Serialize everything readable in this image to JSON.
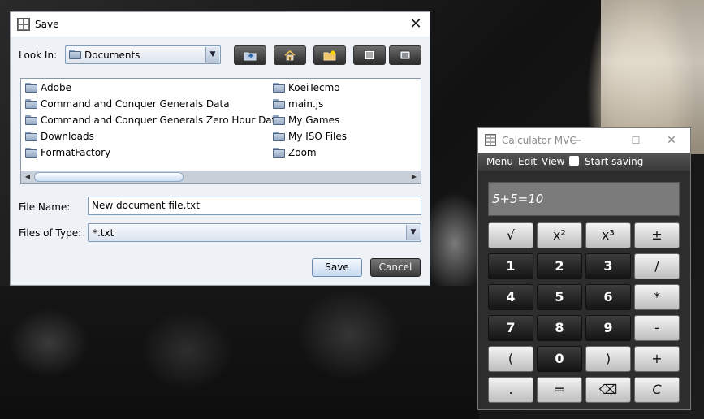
{
  "save_dialog": {
    "title": "Save",
    "close_glyph": "✕",
    "look_in_label": "Look In:",
    "look_in_value": "Documents",
    "toolbar": [
      {
        "icon": "up-folder-icon"
      },
      {
        "icon": "home-icon"
      },
      {
        "icon": "new-folder-icon"
      },
      {
        "icon": "list-view-icon"
      },
      {
        "icon": "details-view-icon"
      }
    ],
    "files_col1": [
      "Adobe",
      "Command and Conquer Generals Data",
      "Command and Conquer Generals Zero Hour Data",
      "Downloads",
      "FormatFactory"
    ],
    "files_col2": [
      "KoeiTecmo",
      "main.js",
      "My Games",
      "My ISO Files",
      "Zoom"
    ],
    "file_name_label": "File Name:",
    "file_name_value": "New document file.txt",
    "files_of_type_label": "Files of Type:",
    "files_of_type_value": "*.txt",
    "save_label": "Save",
    "cancel_label": "Cancel"
  },
  "calculator": {
    "title": "Calculator MVC",
    "menu": [
      "Menu",
      "Edit",
      "View"
    ],
    "start_saving_label": "Start saving",
    "display": "5+5=10",
    "keys": [
      [
        "√",
        "x²",
        "x³",
        "±"
      ],
      [
        "1",
        "2",
        "3",
        "/"
      ],
      [
        "4",
        "5",
        "6",
        "*"
      ],
      [
        "7",
        "8",
        "9",
        "-"
      ],
      [
        "(",
        "0",
        ")",
        "+"
      ],
      [
        ".",
        "=",
        "⌫",
        "C"
      ]
    ]
  }
}
